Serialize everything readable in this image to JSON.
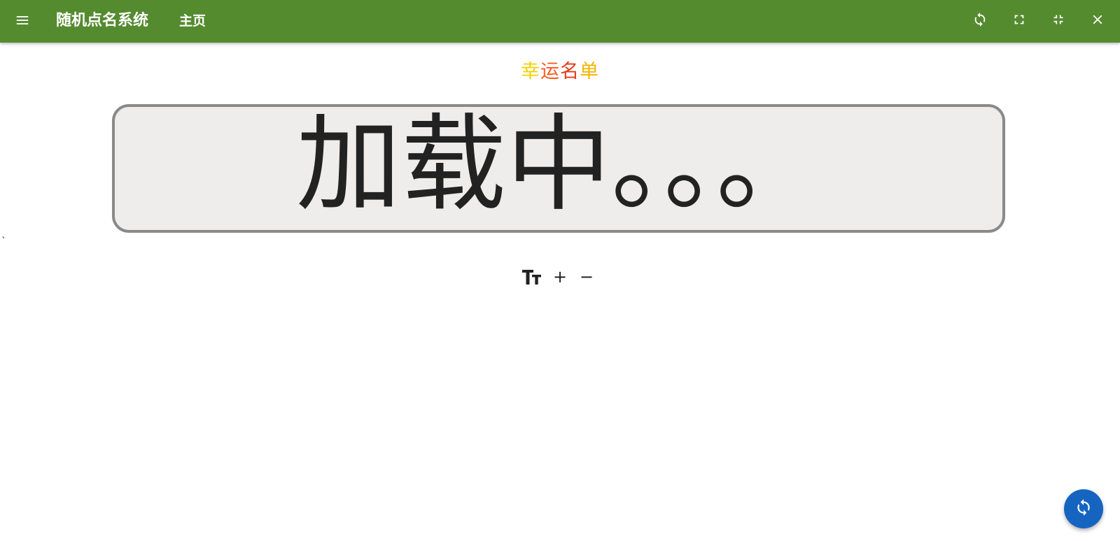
{
  "appbar": {
    "title": "随机点名系统",
    "nav_home": "主页",
    "color": "#558b2f",
    "icons": {
      "menu": "menu-icon",
      "refresh": "refresh-icon",
      "fullscreen": "fullscreen-icon",
      "exit_fullscreen": "exit-fullscreen-icon",
      "close": "close-icon"
    }
  },
  "lucky": {
    "chars": [
      "幸",
      "运",
      "名",
      "单"
    ],
    "colors": [
      "#f2d000",
      "#ff5a1f",
      "#e63a1a",
      "#f5b400"
    ]
  },
  "display": {
    "text": "加载中。。。",
    "border_color": "#8a8a8a",
    "background": "#eeedeb"
  },
  "stray_mark": "`",
  "font_controls": {
    "icon": "text-size-icon",
    "increase_label": "+",
    "decrease_label": "−"
  },
  "fab": {
    "icon": "shuffle-sync-icon",
    "color": "#1565c0"
  }
}
